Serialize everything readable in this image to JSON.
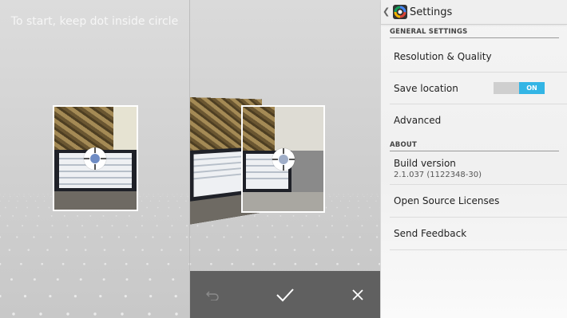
{
  "capture": {
    "hint": "To start, keep dot inside circle",
    "actions": {
      "undo_icon": "undo-icon",
      "confirm_icon": "checkmark-icon",
      "cancel_icon": "close-icon"
    }
  },
  "settings": {
    "header": {
      "back_icon": "back-chevron-icon",
      "app_icon": "camera-app-icon",
      "title": "Settings"
    },
    "sections": [
      {
        "title": "GENERAL SETTINGS"
      },
      {
        "title": "ABOUT"
      }
    ],
    "items": {
      "resolution": "Resolution & Quality",
      "save_location": {
        "label": "Save location",
        "toggle": "ON",
        "enabled": true
      },
      "advanced": "Advanced",
      "build": {
        "label": "Build version",
        "value": "2.1.037 (1122348-30)"
      },
      "licenses": "Open Source Licenses",
      "feedback": "Send Feedback"
    },
    "colors": {
      "toggle_on": "#33b5e5",
      "accent_dot": "#6f8cc4"
    }
  }
}
